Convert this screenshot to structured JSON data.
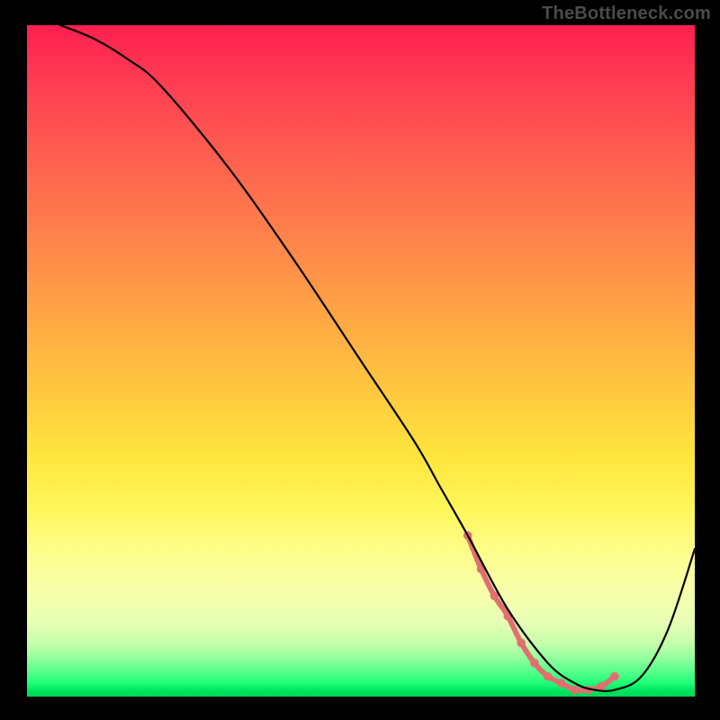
{
  "watermark": "TheBottleneck.com",
  "chart_data": {
    "type": "line",
    "title": "",
    "xlabel": "",
    "ylabel": "",
    "xlim": [
      0,
      100
    ],
    "ylim": [
      0,
      100
    ],
    "grid": false,
    "series": [
      {
        "name": "bottleneck-curve",
        "x": [
          5,
          10,
          15,
          20,
          30,
          40,
          50,
          58,
          62,
          66,
          72,
          78,
          82,
          85,
          88,
          92,
          96,
          100
        ],
        "y": [
          100,
          98,
          95,
          91,
          79,
          65,
          50,
          38,
          31,
          24,
          13,
          5,
          2,
          1,
          1,
          3,
          10,
          22
        ],
        "stroke": "#000000",
        "stroke_width": 2.2
      }
    ],
    "highlight": {
      "name": "optimal-range-highlight",
      "color": "#e0706f",
      "dot_radius": 4.8,
      "line_width": 6,
      "points_x": [
        66,
        68,
        70,
        72,
        74,
        76,
        78,
        80,
        82,
        84,
        86,
        88
      ],
      "points_y": [
        24,
        19,
        15,
        12,
        8,
        5,
        3,
        2,
        1,
        1,
        1.5,
        3
      ]
    }
  }
}
